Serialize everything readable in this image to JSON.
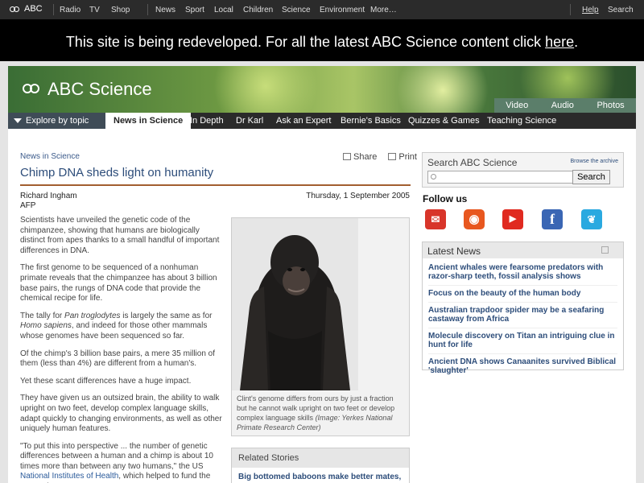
{
  "topbar": {
    "logo_text": "ABC",
    "links": [
      "Radio",
      "TV",
      "Shop",
      "News",
      "Sport",
      "Local",
      "Children",
      "Science",
      "Environment",
      "More…"
    ],
    "help": "Help",
    "search": "Search"
  },
  "banner": {
    "text": "This site is being redeveloped. For all the latest ABC Science content click ",
    "link": "here",
    "end": "."
  },
  "header": {
    "brand": "ABC Science",
    "subnav": [
      "Video",
      "Audio",
      "Photos"
    ]
  },
  "nav": {
    "explore": "Explore by topic",
    "tabs": [
      "News in Science",
      "In Depth",
      "Dr Karl",
      "Ask an Expert",
      "Bernie's Basics",
      "Quizzes & Games",
      "Teaching Science"
    ]
  },
  "article": {
    "breadcrumb": "News in Science",
    "share": "Share",
    "print": "Print",
    "title": "Chimp DNA sheds light on humanity",
    "author": "Richard Ingham",
    "agency": "AFP",
    "date": "Thursday, 1 September 2005",
    "p1": "Scientists have unveiled the genetic code of the chimpanzee, showing that humans are biologically distinct from apes thanks to a small handful of important differences in DNA.",
    "p2": "The first genome to be sequenced of a nonhuman primate reveals that the chimpanzee has about 3 billion base pairs, the rungs of DNA code that provide the chemical recipe for life.",
    "p3a": "The tally for ",
    "p3b": "Pan troglodytes",
    "p3c": " is largely the same as for ",
    "p3d": "Homo sapiens",
    "p3e": ", and indeed for those other mammals whose genomes have been sequenced so far.",
    "p4": "Of the chimp's 3 billion base pairs, a mere 35 million of them (less than 4%) are different from a human's.",
    "p5": "Yet these scant differences have a huge impact.",
    "p6": "They have given us an outsized brain, the ability to walk upright on two feet, develop complex language skills, adapt quickly to changing environments, as well as other uniquely human features.",
    "p7a": "\"To put this into perspective ... the number of genetic differences between a human and a chimp is about 10 times more than between any two humans,\" the US ",
    "p7link": "National Institutes of Health",
    "p7b": ", which helped to fund the research, notes.",
    "caption": "Clint's genome differs from ours by just a fraction but he cannot walk upright on two feet or develop complex language skills ",
    "caption_credit": "(Image: Yerkes National Primate Research Center)"
  },
  "related": {
    "heading": "Related Stories",
    "first": "Big bottomed baboons make better mates,"
  },
  "sidebar": {
    "search_heading": "Search ABC Science",
    "browse": "Browse the archive",
    "search_button": "Search",
    "search_value": "",
    "follow": "Follow us",
    "latest_heading": "Latest News",
    "latest": [
      "Ancient whales were fearsome predators with razor-sharp teeth, fossil analysis shows",
      "Focus on the beauty of the human body",
      "Australian trapdoor spider may be a seafaring castaway from Africa",
      "Molecule discovery on Titan an intriguing clue in hunt for life",
      "Ancient DNA shows Canaanites survived Biblical 'slaughter'"
    ]
  },
  "colors": {
    "link": "#2d4d7a",
    "rule": "#a25e2f",
    "mail": "#d8352a",
    "podcast": "#e8571f",
    "youtube": "#e02a20",
    "facebook": "#3a66b4",
    "twitter": "#2aa9e0"
  },
  "icons": [
    "abc-logo-icon",
    "share-icon",
    "print-icon",
    "search-icon",
    "mail-icon",
    "podcast-icon",
    "youtube-icon",
    "facebook-icon",
    "twitter-icon",
    "rss-icon"
  ]
}
